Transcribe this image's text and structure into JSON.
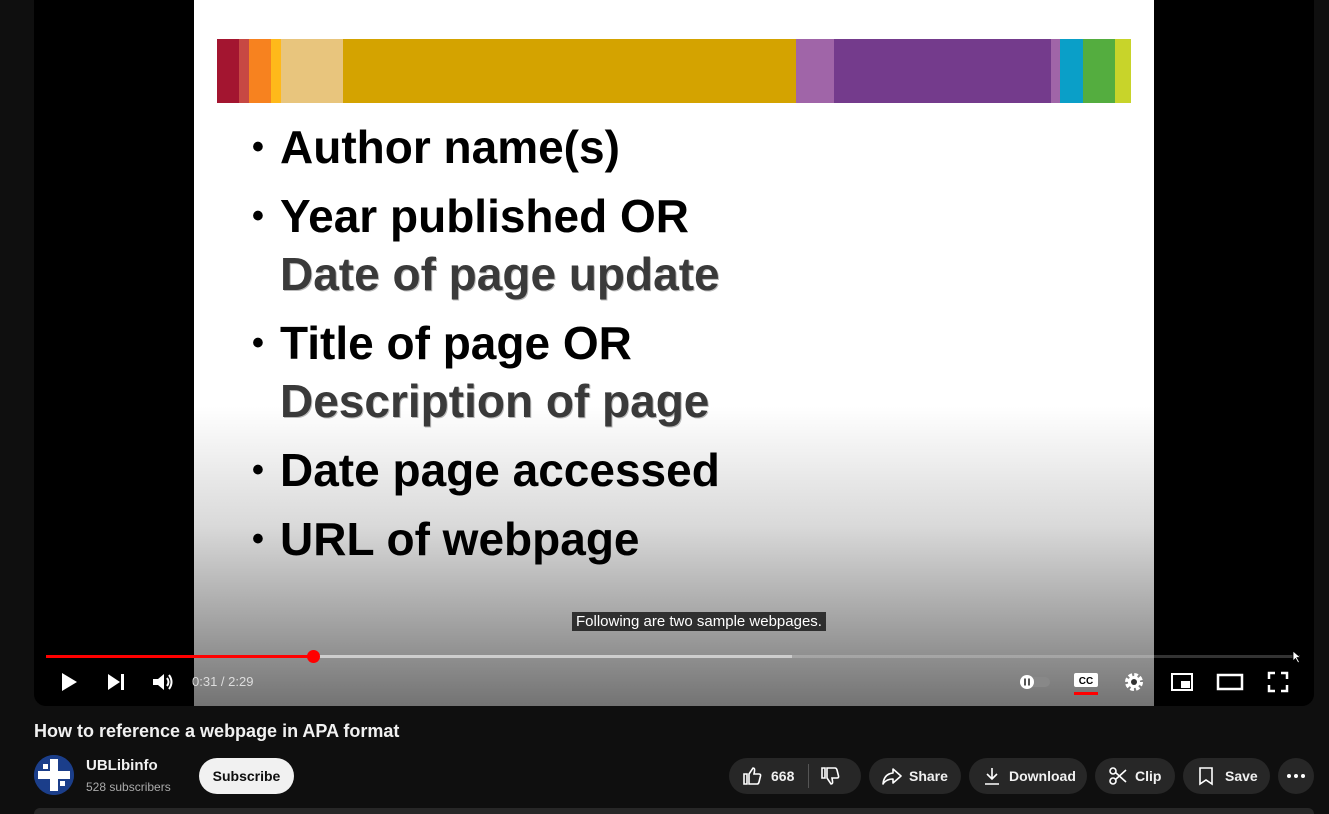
{
  "video": {
    "slide": {
      "colors": [
        "#a31530",
        "#c74843",
        "#f7821f",
        "#ffb91a",
        "#e8c57d",
        "#d4a300",
        "#a065a8",
        "#743b8c",
        "#a065a8",
        "#0a9fc8",
        "#54ad3f",
        "#c8d42a"
      ],
      "bullets": [
        {
          "main": "Author name(s)",
          "sub": ""
        },
        {
          "main": "Year published OR",
          "sub": "Date of page update"
        },
        {
          "main": "Title of page OR",
          "sub": "Description of page"
        },
        {
          "main": "Date page accessed",
          "sub": ""
        },
        {
          "main": "URL of webpage",
          "sub": ""
        }
      ],
      "bullet_char": "•"
    },
    "caption": "Following are two sample webpages.",
    "progress": {
      "played_fraction": 0.213,
      "buffered_fraction": 0.595
    },
    "time": {
      "current": "0:31",
      "separator": " / ",
      "duration": "2:29"
    },
    "accent": "#ff0000"
  },
  "controls": {
    "left": [
      "play-icon",
      "next-icon",
      "volume-icon"
    ],
    "right": [
      "autoplay-toggle-icon",
      "captions-icon",
      "settings-icon",
      "miniplayer-icon",
      "theater-icon",
      "fullscreen-icon"
    ]
  },
  "title": "How to reference a webpage in APA format",
  "channel": {
    "name": "UBLibinfo",
    "subscribers": "528 subscribers",
    "subscribe_label": "Subscribe"
  },
  "actions": {
    "likes": "668",
    "share": "Share",
    "download": "Download",
    "clip": "Clip",
    "save": "Save"
  }
}
